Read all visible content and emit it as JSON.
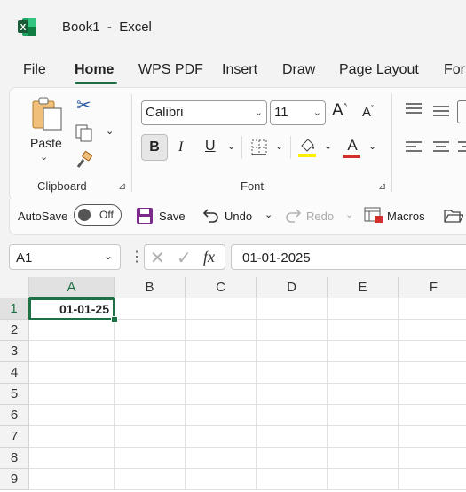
{
  "app": {
    "title": "Book1  -  Excel",
    "logo_letter": "X"
  },
  "tabs": [
    "File",
    "Home",
    "WPS PDF",
    "Insert",
    "Draw",
    "Page Layout",
    "For"
  ],
  "active_tab": "Home",
  "ribbon": {
    "clipboard": {
      "paste_label": "Paste",
      "group_label": "Clipboard"
    },
    "font": {
      "font_name": "Calibri",
      "font_size": "11",
      "grow_label": "A",
      "shrink_label": "A",
      "bold_label": "B",
      "italic_label": "I",
      "underline_label": "U",
      "font_color_label": "A",
      "group_label": "Font"
    }
  },
  "quick_access": {
    "autosave_label": "AutoSave",
    "autosave_state": "Off",
    "save_label": "Save",
    "undo_label": "Undo",
    "redo_label": "Redo",
    "macros_label": "Macros"
  },
  "formula_bar": {
    "name_box": "A1",
    "fx_label": "fx",
    "formula_value": "01-01-2025"
  },
  "sheet": {
    "columns": [
      "A",
      "B",
      "C",
      "D",
      "E",
      "F"
    ],
    "rows": [
      "1",
      "2",
      "3",
      "4",
      "5",
      "6",
      "7",
      "8",
      "9"
    ],
    "cell_a1": "01-01-25",
    "selected_cell": "A1"
  },
  "colors": {
    "excel_green": "#1e7145",
    "highlight_yellow": "#ffee00",
    "font_red": "#d32f2f"
  }
}
